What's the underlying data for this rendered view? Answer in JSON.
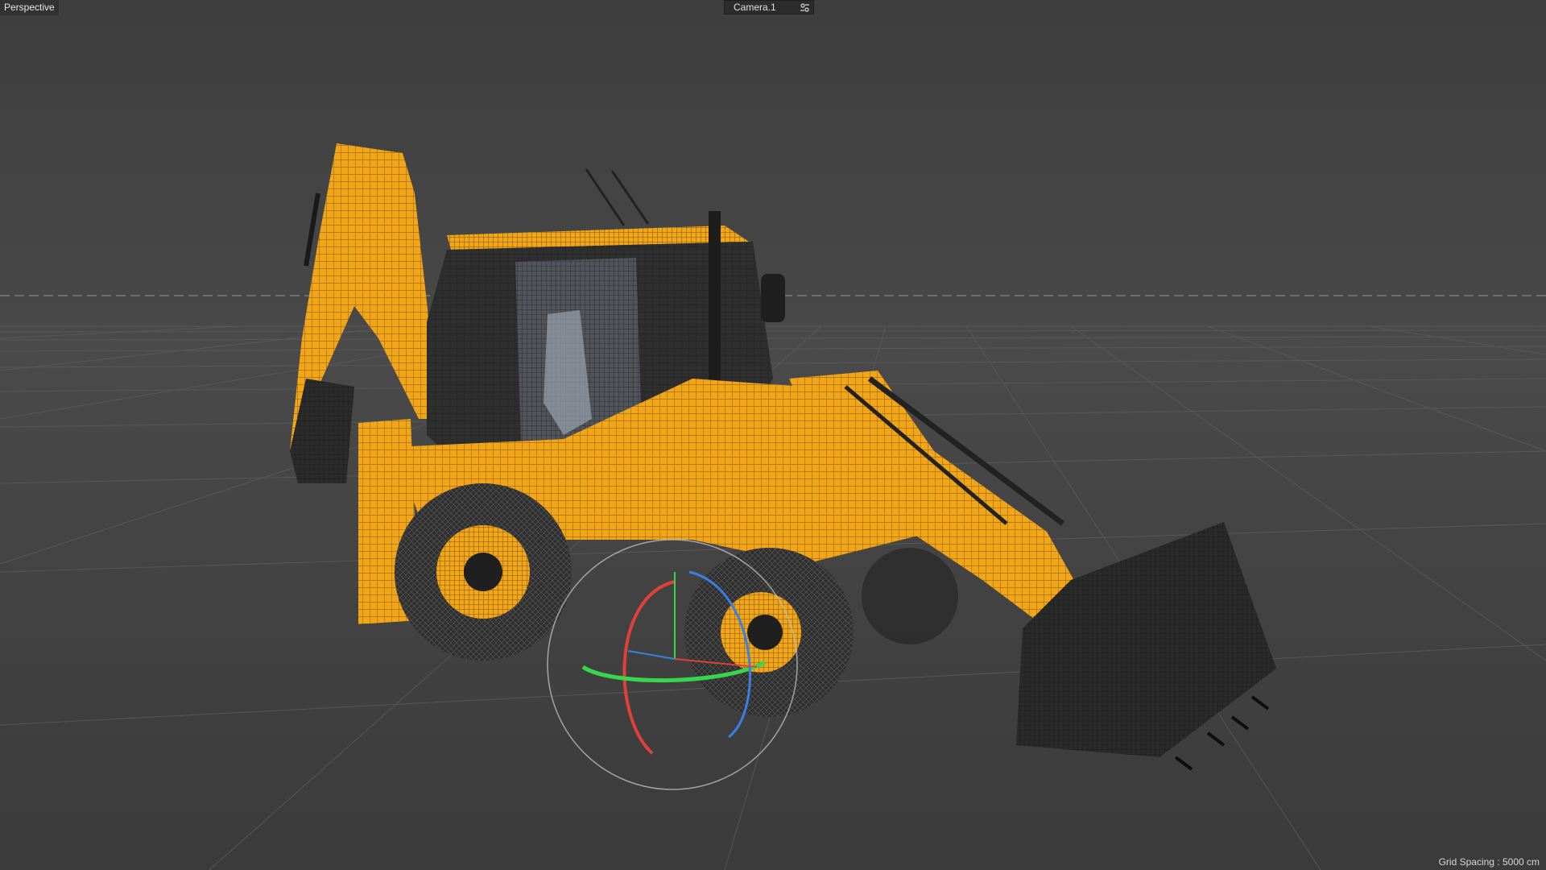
{
  "viewport": {
    "view_name": "Perspective",
    "camera_name": "Camera.1",
    "grid_spacing_text": "Grid Spacing : 5000 cm"
  },
  "icons": {
    "camera_dropdown": "camera-settings-icon"
  },
  "colors": {
    "background": "#474747",
    "grid_line": "#5c5c5c",
    "horizon": "#7a7a7a",
    "model_body": "#f2a516",
    "model_dark": "#2a2a2a",
    "axis_x": "#e0403a",
    "axis_y": "#38d64e",
    "axis_z": "#3c7fe0"
  }
}
